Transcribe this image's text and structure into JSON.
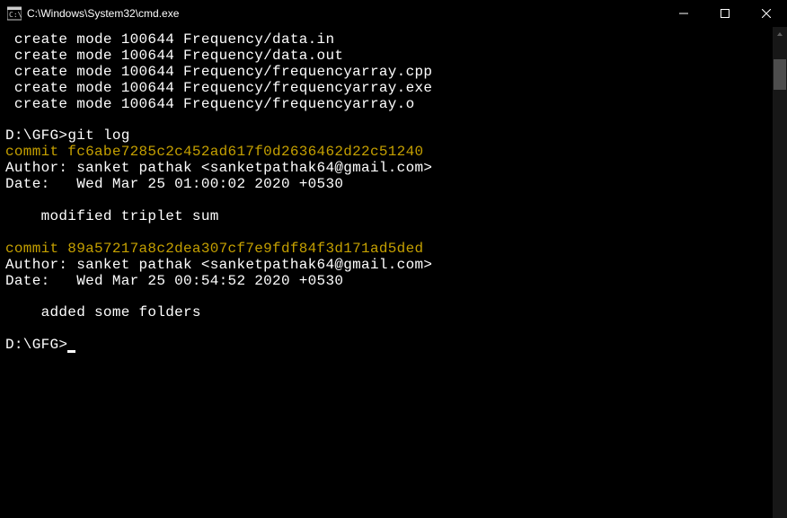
{
  "window": {
    "title": "C:\\Windows\\System32\\cmd.exe"
  },
  "createLines": [
    " create mode 100644 Frequency/data.in",
    " create mode 100644 Frequency/data.out",
    " create mode 100644 Frequency/frequencyarray.cpp",
    " create mode 100644 Frequency/frequencyarray.exe",
    " create mode 100644 Frequency/frequencyarray.o"
  ],
  "prompt1": {
    "prefix": "D:\\GFG>",
    "command": "git log"
  },
  "commits": [
    {
      "hashLine": "commit fc6abe7285c2c452ad617f0d2636462d22c51240",
      "author": "Author: sanket pathak <sanketpathak64@gmail.com>",
      "date": "Date:   Wed Mar 25 01:00:02 2020 +0530",
      "message": "    modified triplet sum"
    },
    {
      "hashLine": "commit 89a57217a8c2dea307cf7e9fdf84f3d171ad5ded",
      "author": "Author: sanket pathak <sanketpathak64@gmail.com>",
      "date": "Date:   Wed Mar 25 00:54:52 2020 +0530",
      "message": "    added some folders"
    }
  ],
  "prompt2": {
    "prefix": "D:\\GFG>"
  }
}
